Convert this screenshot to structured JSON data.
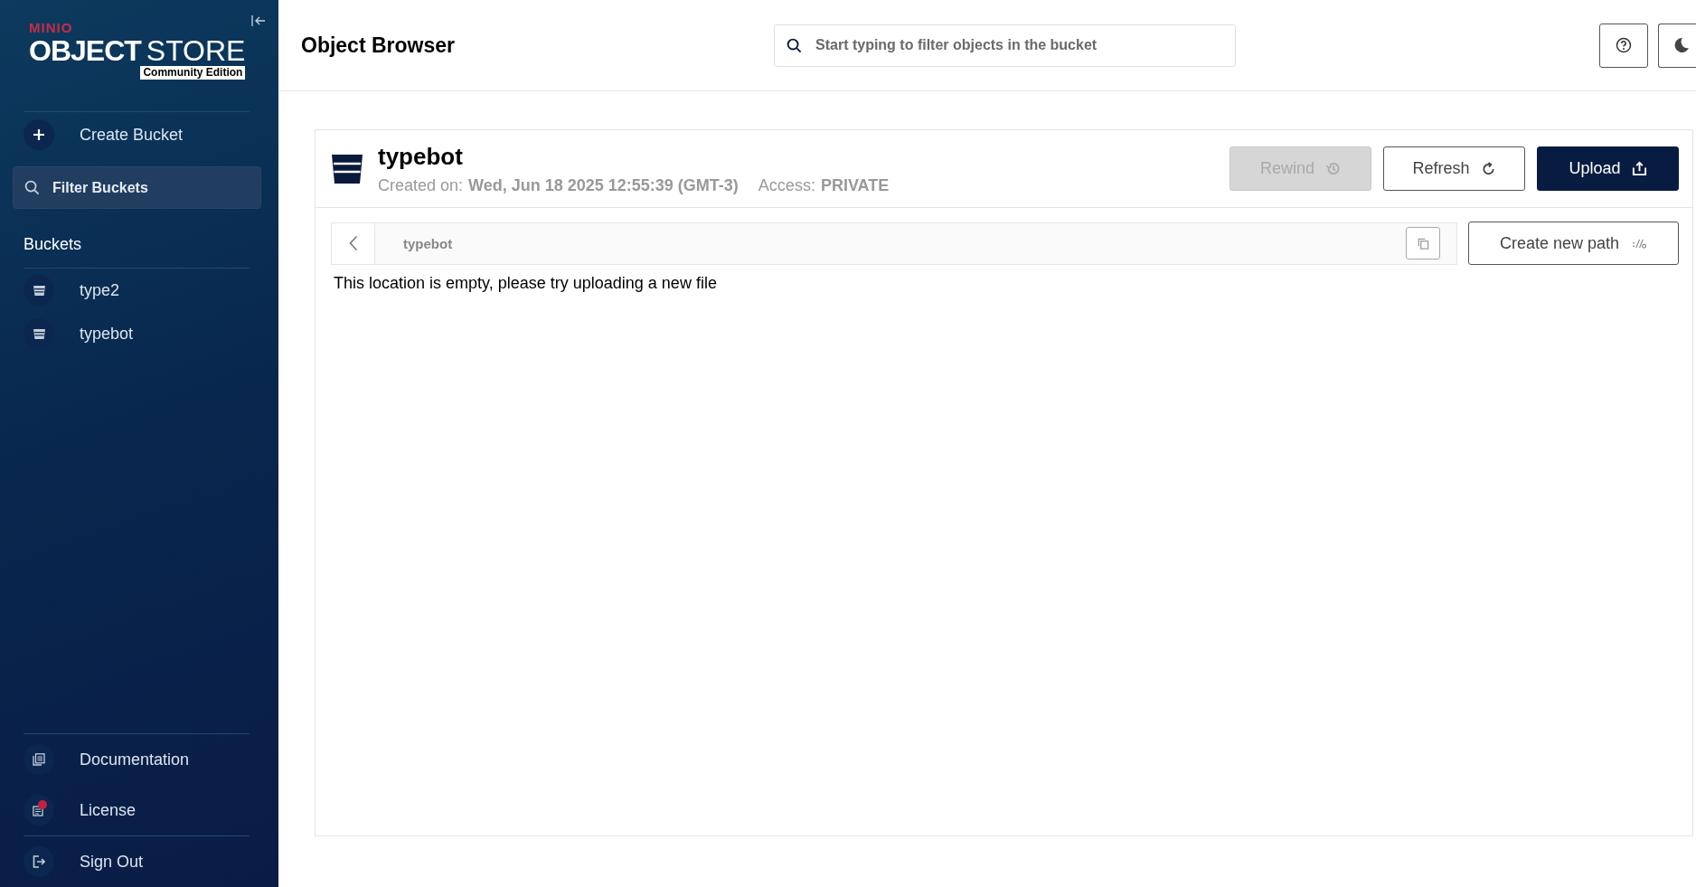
{
  "sidebar": {
    "logo": {
      "brand": "MINIO",
      "product_bold": "OBJECT",
      "product_light": "STORE",
      "edition": "Community Edition"
    },
    "create_bucket": "Create Bucket",
    "filter": {
      "placeholder": "Filter Buckets"
    },
    "buckets_heading": "Buckets",
    "buckets": [
      {
        "name": "type2"
      },
      {
        "name": "typebot"
      }
    ],
    "footer_items": [
      {
        "kind": "docs",
        "label": "Documentation",
        "notification": false
      },
      {
        "kind": "license",
        "label": "License",
        "notification": true
      },
      {
        "kind": "signout",
        "label": "Sign Out",
        "notification": false
      }
    ]
  },
  "header": {
    "title": "Object Browser",
    "search": {
      "placeholder": "Start typing to filter objects in the bucket"
    }
  },
  "bucket": {
    "name": "typebot",
    "created_label": "Created on:",
    "created_value": "Wed, Jun 18 2025 12:55:39 (GMT-3)",
    "access_label": "Access:",
    "access_value": "PRIVATE",
    "actions": [
      {
        "kind": "rewind",
        "label": "Rewind",
        "disabled": true
      },
      {
        "kind": "refresh",
        "label": "Refresh",
        "disabled": false
      },
      {
        "kind": "upload",
        "label": "Upload",
        "disabled": false
      }
    ],
    "path": "typebot",
    "create_path": "Create new path",
    "empty_message": "This location is empty, please try uploading a new file"
  }
}
